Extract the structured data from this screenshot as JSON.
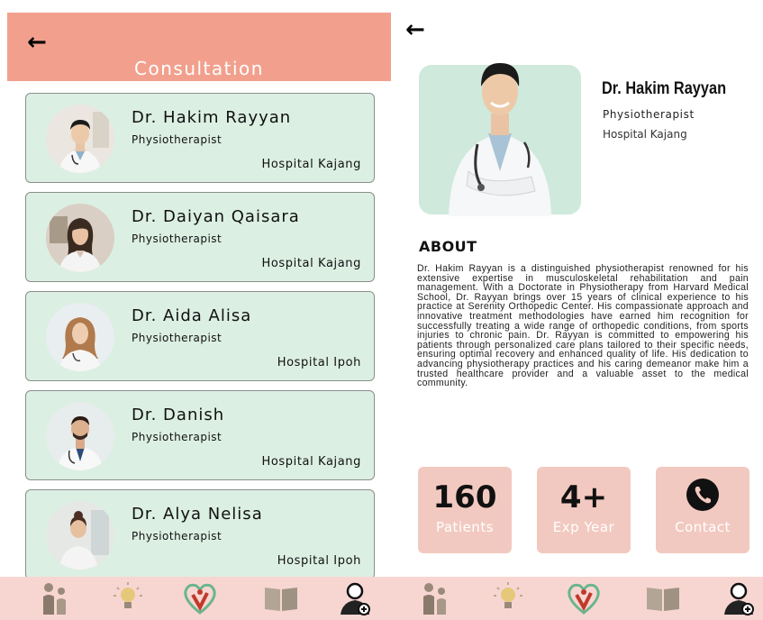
{
  "left": {
    "back_icon": "back-arrow-icon",
    "title": "Consultation",
    "doctors": [
      {
        "name": "Dr. Hakim Rayyan",
        "role": "Physiotherapist",
        "hospital": "Hospital Kajang"
      },
      {
        "name": "Dr. Daiyan Qaisara",
        "role": "Physiotherapist",
        "hospital": "Hospital Kajang"
      },
      {
        "name": "Dr. Aida Alisa",
        "role": "Physiotherapist",
        "hospital": "Hospital Ipoh"
      },
      {
        "name": "Dr. Danish",
        "role": "Physiotherapist",
        "hospital": "Hospital Kajang"
      },
      {
        "name": "Dr. Alya Nelisa",
        "role": "Physiotherapist",
        "hospital": "Hospital Ipoh"
      }
    ]
  },
  "right": {
    "back_icon": "back-arrow-icon",
    "profile": {
      "name": "Dr. Hakim Rayyan",
      "role": "Physiotherapist",
      "hospital": "Hospital Kajang"
    },
    "about_title": "ABOUT",
    "about_text": "Dr. Hakim Rayyan is a distinguished physiotherapist renowned for his extensive expertise in musculoskeletal rehabilitation and pain management. With a Doctorate in Physiotherapy from Harvard Medical School, Dr. Rayyan brings over 15 years of clinical experience to his practice at Serenity Orthopedic Center. His compassionate approach and innovative treatment methodologies have earned him recognition for successfully treating a wide range of orthopedic conditions, from sports injuries to chronic pain. Dr. Rayyan is committed to empowering his patients through personalized care plans tailored to their specific needs, ensuring optimal recovery and enhanced quality of life. His dedication to advancing physiotherapy practices and his caring demeanor make him a trusted healthcare provider and a valuable asset to the medical community.",
    "stats": [
      {
        "value": "160",
        "label": "Patients"
      },
      {
        "value": "4+",
        "label": "Exp Year"
      },
      {
        "value": "",
        "label": "Contact",
        "icon": "phone-icon"
      }
    ]
  },
  "nav": {
    "icons": [
      "family-icon",
      "lightbulb-icon",
      "heart-person-icon",
      "book-icon",
      "doctor-icon"
    ]
  },
  "colors": {
    "header": "#f2a08d",
    "card_bg": "#dcefe3",
    "profile_bg": "#cfe9dc",
    "stat_bg": "#f2c9c0",
    "nav_bg": "#f7d6d2",
    "heart": "#c0392b"
  }
}
